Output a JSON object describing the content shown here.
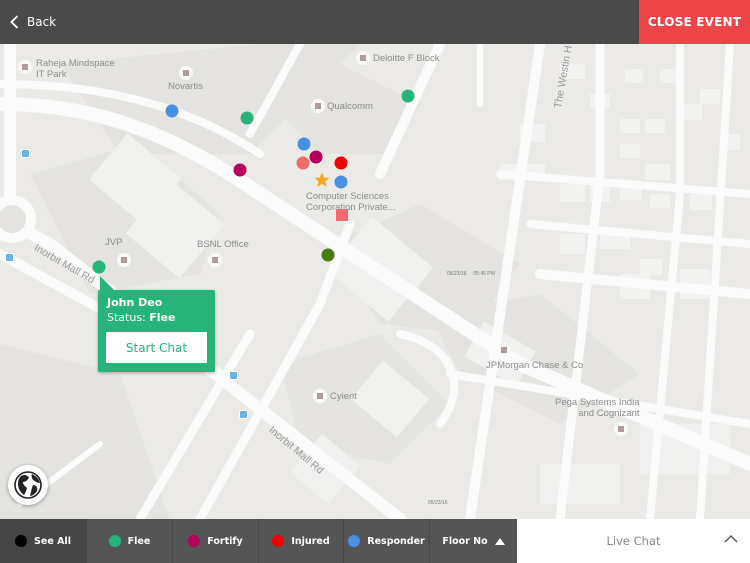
{
  "topbar": {
    "back_label": "Back",
    "close_label": "CLOSE EVENT",
    "close_color": "#ef4548"
  },
  "map": {
    "pois": [
      {
        "label": "Raheja Mindspace\nIT Park"
      },
      {
        "label": "Novartis"
      },
      {
        "label": "Deloitte F Block"
      },
      {
        "label": "Qualcomm"
      },
      {
        "label": "Computer Sciences\nCorporation Private..."
      },
      {
        "label": "JVP"
      },
      {
        "label": "BSNL Office"
      },
      {
        "label": "JPMorgan Chase & Co"
      },
      {
        "label": "Cyient"
      },
      {
        "label": "Pega Systems India\nand Cognizant"
      }
    ],
    "roads": [
      {
        "label": "Inorbit Mall Rd"
      },
      {
        "label": "Inorbit Mall Rd"
      },
      {
        "label": "The Westin H"
      }
    ],
    "timestamps": [
      {
        "label": "05/23/16     05:45 PM"
      },
      {
        "label": "05/23/16"
      }
    ],
    "markers": [
      {
        "type": "responder",
        "color": "#4a90e2"
      },
      {
        "type": "flee",
        "color": "#27b47a"
      },
      {
        "type": "flee",
        "color": "#27b47a"
      },
      {
        "type": "responder",
        "color": "#4a90e2"
      },
      {
        "type": "injured-light",
        "color": "#f06b6e"
      },
      {
        "type": "fortify",
        "color": "#b5005e"
      },
      {
        "type": "injured",
        "color": "#f00000"
      },
      {
        "type": "fortify",
        "color": "#b5005e"
      },
      {
        "type": "responder",
        "color": "#4a90e2"
      },
      {
        "type": "star",
        "color": "#f5a623"
      },
      {
        "type": "square",
        "color": "#f06b6e"
      },
      {
        "type": "dark-green",
        "color": "#4a7a12"
      },
      {
        "type": "flee-selected",
        "color": "#27b47a"
      }
    ]
  },
  "popup": {
    "name": "John Deo",
    "status_label": "Status:",
    "status_value": "Flee",
    "button_label": "Start Chat",
    "color": "#27b47a"
  },
  "globe": {
    "icon": "globe-icon"
  },
  "filters": [
    {
      "label": "See All",
      "color": "#000000",
      "active": true
    },
    {
      "label": "Flee",
      "color": "#27b47a"
    },
    {
      "label": "Fortify",
      "color": "#b5005e"
    },
    {
      "label": "Injured",
      "color": "#f00000"
    },
    {
      "label": "Responder",
      "color": "#4a90e2"
    },
    {
      "label": "Floor No",
      "icon": "triangle-up-icon"
    }
  ],
  "livechat": {
    "label": "Live Chat",
    "icon": "chevron-up-icon"
  }
}
